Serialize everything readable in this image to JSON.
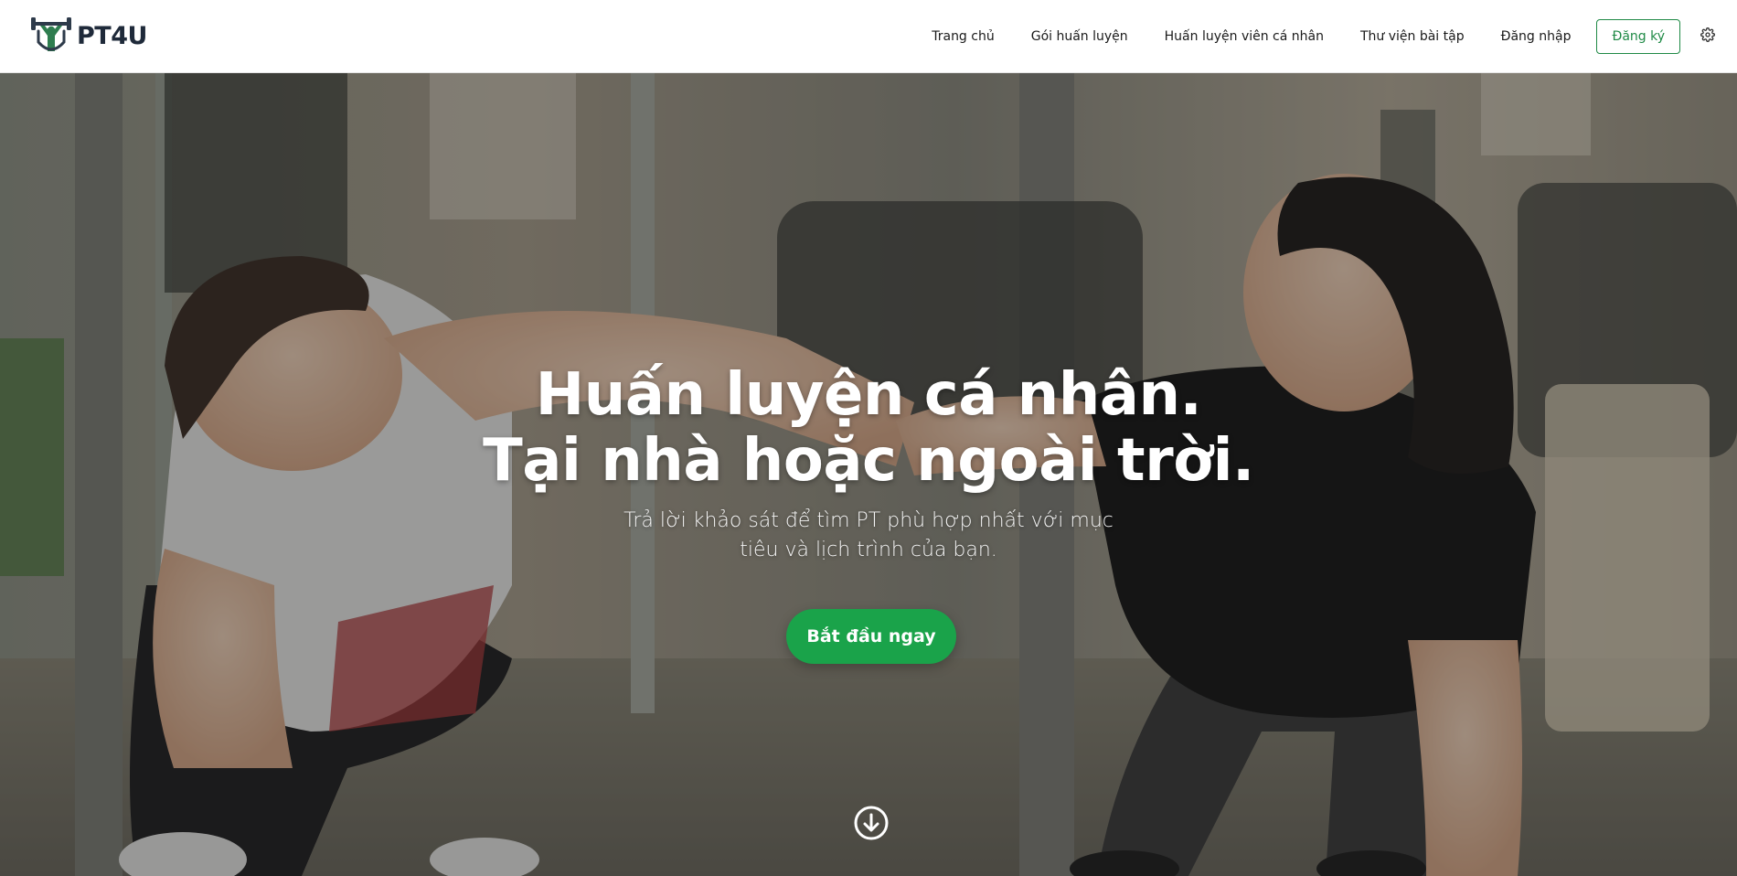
{
  "brand": {
    "name": "PT4U",
    "logo_icon": "dumbbell-person-logo",
    "logo_color": "#2e7d4f"
  },
  "nav": {
    "items": [
      {
        "label": "Trang chủ"
      },
      {
        "label": "Gói huấn luyện"
      },
      {
        "label": "Huấn luyện viên cá nhân"
      },
      {
        "label": "Thư viện bài tập"
      },
      {
        "label": "Đăng nhập"
      }
    ],
    "signup_label": "Đăng ký",
    "settings_icon": "gear-icon"
  },
  "hero": {
    "title_line1": "Huấn luyện cá nhân.",
    "title_line2": "Tại nhà hoặc ngoài trời.",
    "subtitle": "Trả lời khảo sát để tìm PT phù hợp nhất với mục tiêu và lịch trình của bạn.",
    "cta_label": "Bắt đầu ngay",
    "scroll_icon": "arrow-down-circle-icon"
  },
  "colors": {
    "accent": "#1aa34a",
    "accent_outline": "#1f8a46",
    "text_dark": "#1a1a1a"
  }
}
